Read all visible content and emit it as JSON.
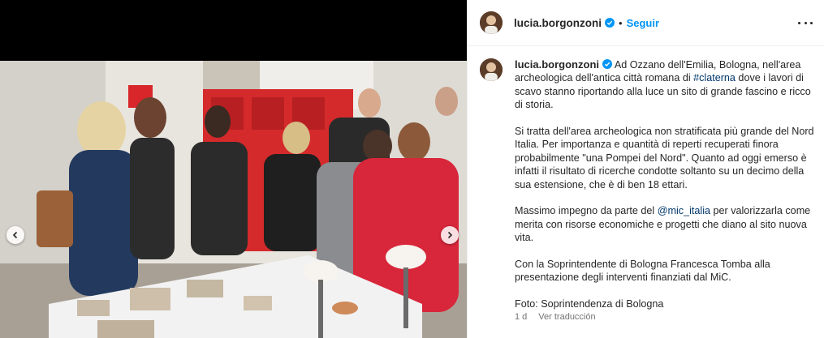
{
  "post": {
    "username": "lucia.borgonzoni",
    "follow_label": "Seguir",
    "separator": "•",
    "caption": {
      "p1_text_before_tag": "Ad Ozzano dell'Emilia, Bologna, nell'area archeologica dell'antica città romana di ",
      "p1_hashtag": "#claterna",
      "p1_text_after_tag": " dove i lavori di scavo stanno riportando alla luce un sito di grande fascino e ricco di storia.",
      "p2": "Si tratta dell'area archeologica non stratificata più grande del Nord Italia. Per importanza e quantità di reperti recuperati finora probabilmente \"una Pompei del Nord\". Quanto ad oggi emerso è infatti il risultato di ricerche condotte soltanto su un decimo della sua estensione, che è di ben 18 ettari.",
      "p3_text_before_mention": "Massimo impegno da parte del ",
      "p3_mention": "@mic_italia",
      "p3_text_after_mention": " per valorizzarla come merita con risorse economiche e progetti che diano al sito nuova vita.",
      "p4": "Con la Soprintendente di Bologna Francesca Tomba alla presentazione degli interventi finanziati dal MiC.",
      "p5": "Foto: Soprintendenza di Bologna"
    },
    "timestamp": "1 d",
    "translate_label": "Ver traducción"
  },
  "icons": {
    "verified": "verified-badge-icon",
    "more": "more-options-icon",
    "prev": "chevron-left-icon",
    "next": "chevron-right-icon"
  },
  "colors": {
    "accent_blue": "#0095f6",
    "link_blue": "#00376b",
    "muted_text": "#737373"
  }
}
